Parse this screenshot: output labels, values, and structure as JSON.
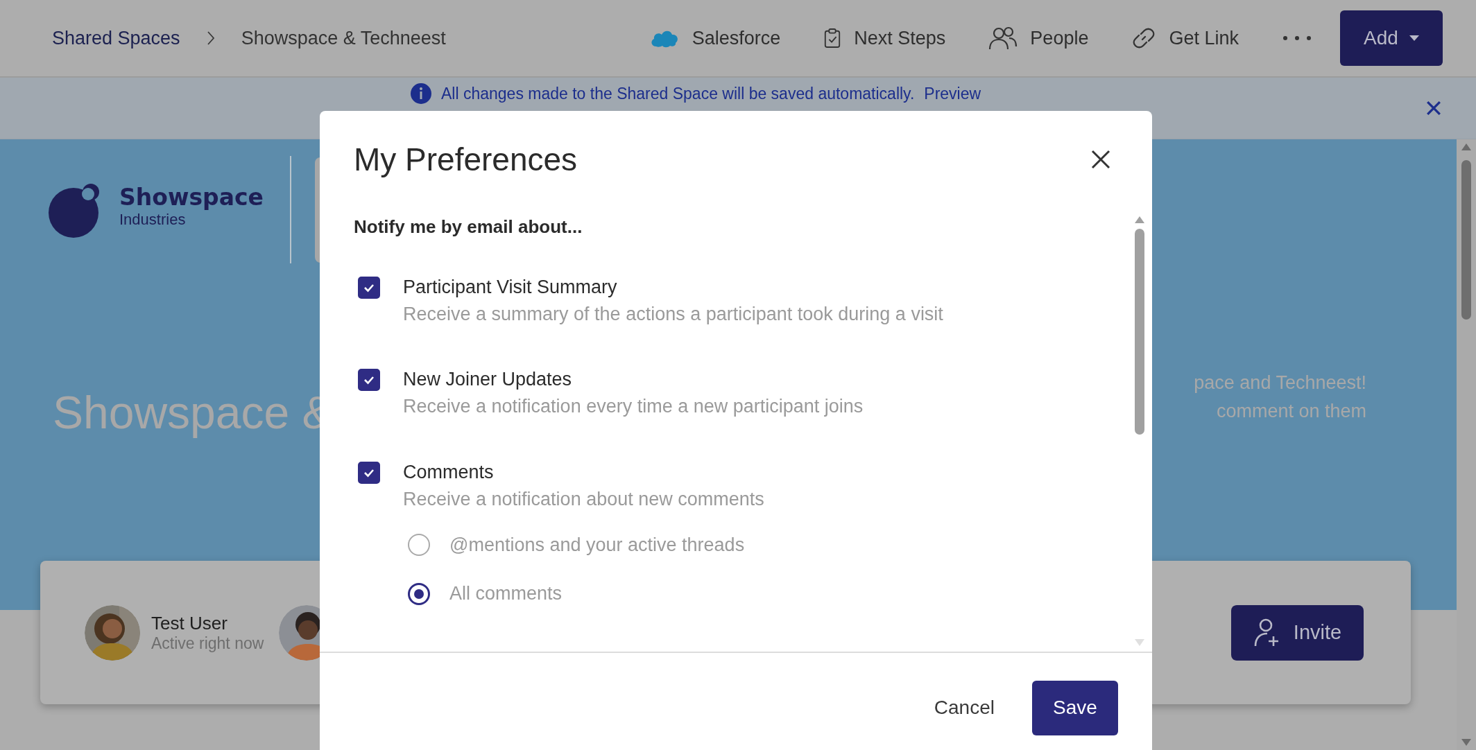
{
  "breadcrumbs": [
    {
      "label": "Shared Spaces"
    },
    {
      "label": "Showspace & Techneest"
    }
  ],
  "toolbar": [
    {
      "label": "Salesforce",
      "kind": "cloud"
    },
    {
      "label": "Next Steps",
      "kind": "clipboard"
    },
    {
      "label": "People",
      "kind": "people"
    },
    {
      "label": "Get Link",
      "kind": "link"
    }
  ],
  "add_button": {
    "label": "Add"
  },
  "banner": {
    "message": "All changes made to the Shared Space will be saved automatically.",
    "link": "Preview"
  },
  "logo": {
    "name": "Showspace",
    "subtitle": "Industries"
  },
  "hero": {
    "title": "Showspace &",
    "lines": [
      "pace and Techneest!",
      "comment on them"
    ]
  },
  "participants": [
    {
      "name": "Test User",
      "status": "Active right now"
    }
  ],
  "invite_button": {
    "label": "Invite"
  },
  "dialog": {
    "title": "My Preferences",
    "heading": "Notify me by email about...",
    "options": [
      {
        "title": "Participant Visit Summary",
        "description": "Receive a summary of the actions a participant took during a visit",
        "checked": true
      },
      {
        "title": "New Joiner Updates",
        "description": "Receive a notification every time a new participant joins",
        "checked": true
      },
      {
        "title": "Comments",
        "description": "Receive a notification about new comments",
        "checked": true
      }
    ],
    "comment_scope": [
      {
        "label": "@mentions and your active threads",
        "selected": false
      },
      {
        "label": "All comments",
        "selected": true
      }
    ],
    "buttons": [
      {
        "label": "Cancel",
        "kind": "text"
      },
      {
        "label": "Save",
        "kind": "primary"
      }
    ]
  }
}
